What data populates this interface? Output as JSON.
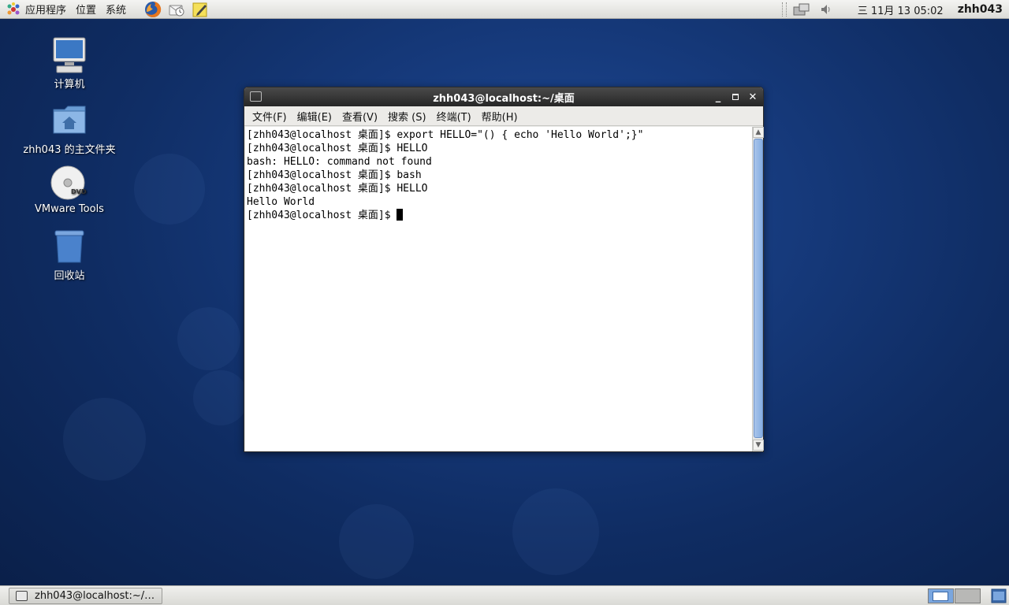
{
  "top_panel": {
    "menus": {
      "applications": "应用程序",
      "places": "位置",
      "system": "系统"
    },
    "clock": "三 11月 13 05:02",
    "username": "zhh043"
  },
  "desktop": {
    "icons": [
      {
        "label": "计算机"
      },
      {
        "label": "zhh043 的主文件夹"
      },
      {
        "label": "VMware Tools"
      },
      {
        "label": "回收站"
      }
    ]
  },
  "terminal": {
    "title": "zhh043@localhost:~/桌面",
    "menu": [
      "文件(F)",
      "编辑(E)",
      "查看(V)",
      "搜索 (S)",
      "终端(T)",
      "帮助(H)"
    ],
    "lines": [
      "[zhh043@localhost 桌面]$ export HELLO=\"() { echo 'Hello World';}\"",
      "[zhh043@localhost 桌面]$ HELLO",
      "bash: HELLO: command not found",
      "[zhh043@localhost 桌面]$ bash",
      "[zhh043@localhost 桌面]$ HELLO",
      "Hello World",
      "[zhh043@localhost 桌面]$ "
    ]
  },
  "taskbar": {
    "task_label": "zhh043@localhost:~/…"
  },
  "colors": {
    "desktop_bg": "#163a7c",
    "title_bar": "#2e2e2e",
    "scroll_thumb": "#86aee2"
  }
}
